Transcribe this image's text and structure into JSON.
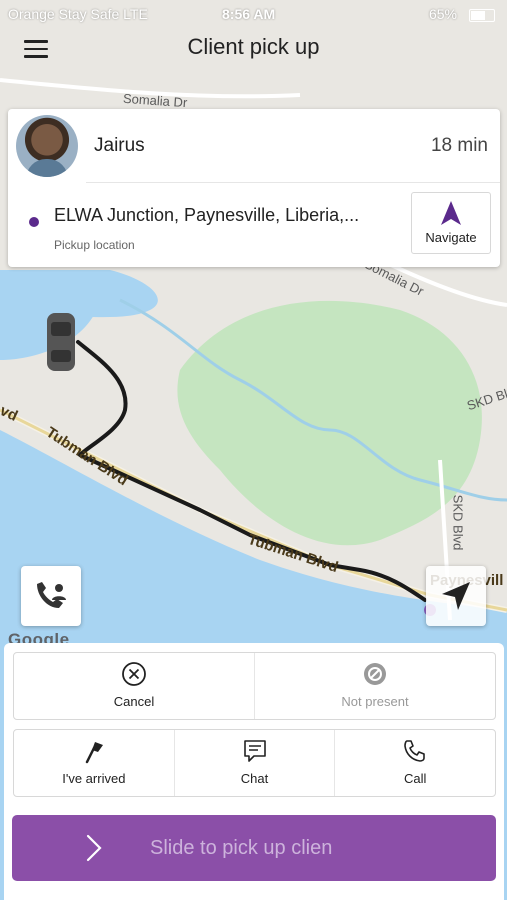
{
  "status_bar": {
    "carrier": "Orange Stay Safe  LTE",
    "time": "8:56 AM",
    "battery": "65%"
  },
  "header": {
    "title": "Client pick up",
    "menu_icon": "hamburger-menu-icon"
  },
  "map": {
    "road_labels": [
      "Somalia Dr",
      "Somalia Dr",
      "Tubman Blvd",
      "Tubman Blvd",
      "SKD Blvd",
      "SKD Blvd",
      "vd",
      "Paynesvill"
    ],
    "google_logo": "Google",
    "colors": {
      "land": "#e9e7e2",
      "water": "#a8d4f2",
      "park": "#c5e5c0",
      "route": "#1a1a1a"
    }
  },
  "client_card": {
    "name": "Jairus",
    "eta": "18 min",
    "pickup_address": "ELWA Junction, Paynesville, Liberia,...",
    "pickup_label": "Pickup location",
    "navigate_label": "Navigate",
    "accent_color": "#5b2a8c"
  },
  "actions": {
    "cancel_label": "Cancel",
    "not_present_label": "Not present",
    "arrived_label": "I've arrived",
    "chat_label": "Chat",
    "call_label": "Call"
  },
  "slide": {
    "label": "Slide to pick up clien",
    "color": "#8b4fa8"
  }
}
